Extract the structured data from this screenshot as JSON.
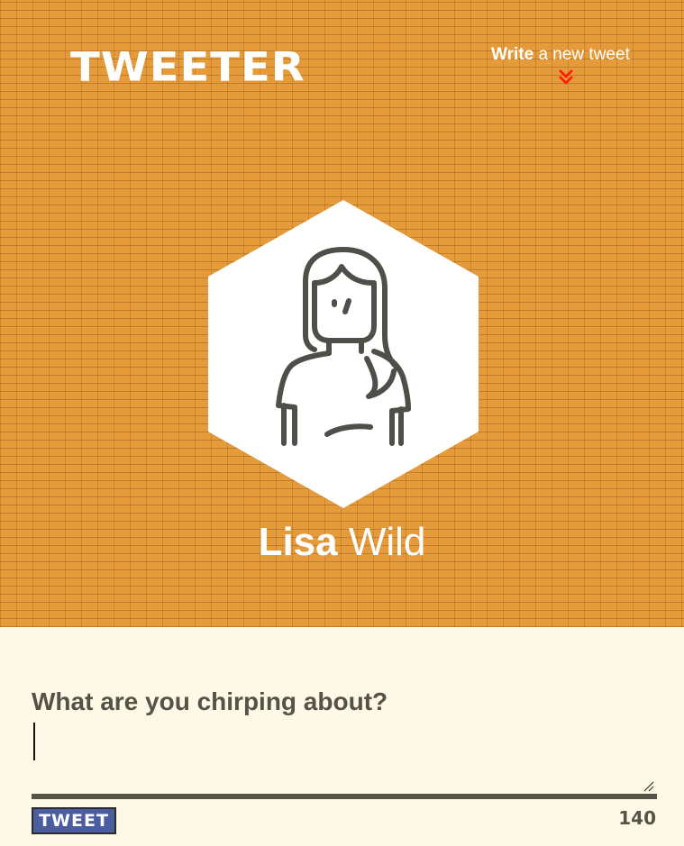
{
  "header": {
    "logo": "TWEETER",
    "write_bold": "Write",
    "write_rest": " a new tweet",
    "chevron_icon": "double-chevron-down-icon",
    "chevron_color": "#ff1a00"
  },
  "profile": {
    "avatar_icon": "woman-avatar-icon",
    "first_name": "Lisa",
    "last_name": " Wild"
  },
  "composer": {
    "prompt": "What are you chirping about?",
    "input_value": "",
    "tweet_button": "TWEET",
    "char_count": "140"
  },
  "colors": {
    "hero_bg": "#e69b3a",
    "composer_bg": "#fdf9e6",
    "button_bg": "#4a5d9e",
    "text_dark": "#555247"
  }
}
